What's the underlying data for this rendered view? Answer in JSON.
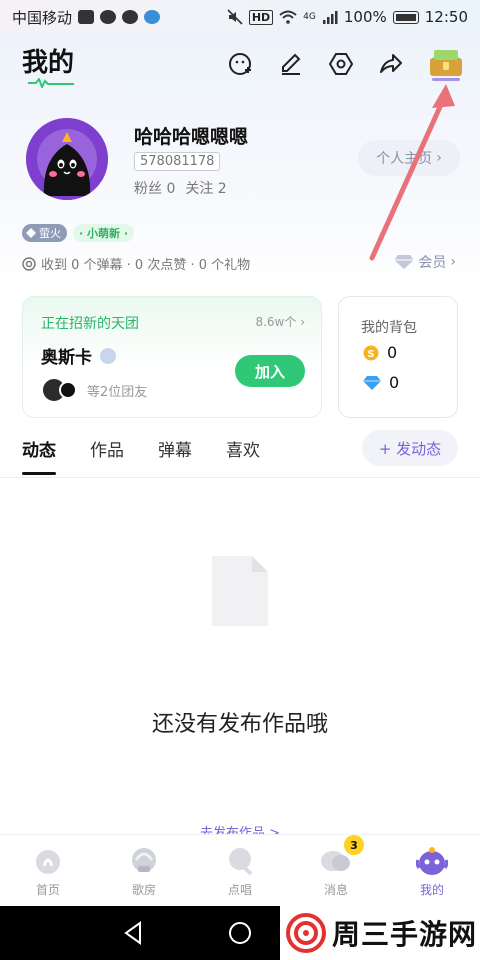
{
  "status_bar": {
    "carrier": "中国移动",
    "hd": "HD",
    "signal": "4G",
    "battery": "100%",
    "time": "12:50"
  },
  "header": {
    "title": "我的",
    "icons": [
      "add-friend-icon",
      "edit-icon",
      "settings-icon",
      "share-icon",
      "treasure-chest-icon"
    ]
  },
  "profile": {
    "username": "哈哈哈嗯嗯嗯",
    "uid": "578081178",
    "fans": "粉丝 0",
    "following": "关注 2",
    "homepage_label": "个人主页",
    "badge_firefly": "萤火",
    "badge_new": "· 小萌新 ·",
    "stats_text": "收到 0 个弹幕 · 0 次点赞 · 0 个礼物",
    "vip_label": "会员"
  },
  "team_card": {
    "heading": "正在招新的天团",
    "count": "8.6w个",
    "team_name": "奥斯卡",
    "join_label": "加入",
    "members_text": "等2位团友"
  },
  "bag_card": {
    "title": "我的背包",
    "coins": "0",
    "diamonds": "0"
  },
  "tabs": [
    "动态",
    "作品",
    "弹幕",
    "喜欢"
  ],
  "post_button": "+ 发动态",
  "empty_state": {
    "message": "还没有发布作品哦",
    "link": "去发布作品 >"
  },
  "bottom_nav": {
    "items": [
      "首页",
      "歌房",
      "点唱",
      "消息",
      "我的"
    ],
    "message_badge": "3"
  },
  "watermark": {
    "text": "周三手游网"
  },
  "colors": {
    "accent": "#7a63d8",
    "green": "#2fc877",
    "annotation_arrow": "#e8717a"
  }
}
